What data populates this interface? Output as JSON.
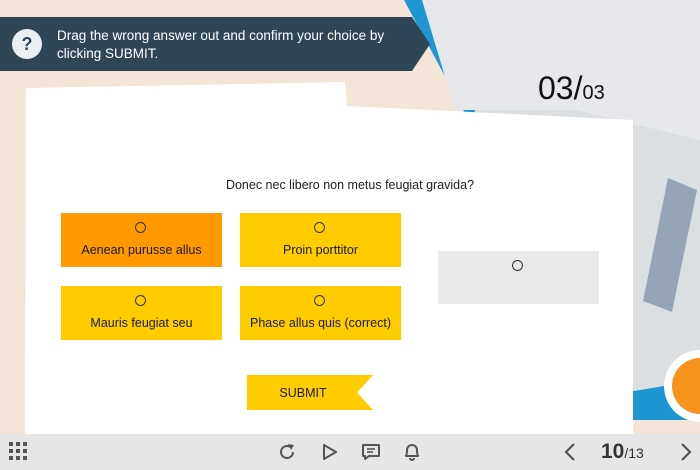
{
  "instruction": {
    "text": "Drag the wrong answer out and confirm your choice by clicking SUBMIT.",
    "help_glyph": "?"
  },
  "counter": {
    "current": "03",
    "separator": "/",
    "total": "03"
  },
  "question": "Donec nec libero non metus feugiat gravida?",
  "options": [
    {
      "label": "Aenean purusse allus",
      "selected": true
    },
    {
      "label": "Proin porttitor",
      "selected": false
    },
    {
      "label": "Mauris feugiat seu",
      "selected": false
    },
    {
      "label": "Phase allus quis (correct)",
      "selected": false
    }
  ],
  "submit_label": "SUBMIT",
  "toolbar": {
    "icons": [
      "menu-grid-icon",
      "replay-icon",
      "play-icon",
      "transcript-icon",
      "bell-icon",
      "prev-arrow-icon",
      "next-arrow-icon"
    ]
  },
  "pagination": {
    "current": "10",
    "separator": "/",
    "total": "13"
  },
  "colors": {
    "background": "#f3e5d8",
    "instruction_bar": "#2f4656",
    "option": "#ffcc00",
    "option_selected": "#ff9900",
    "dropzone": "#e9e9e9",
    "folder_blue": "#1e96d2",
    "toolbar": "#e6e6e6"
  }
}
